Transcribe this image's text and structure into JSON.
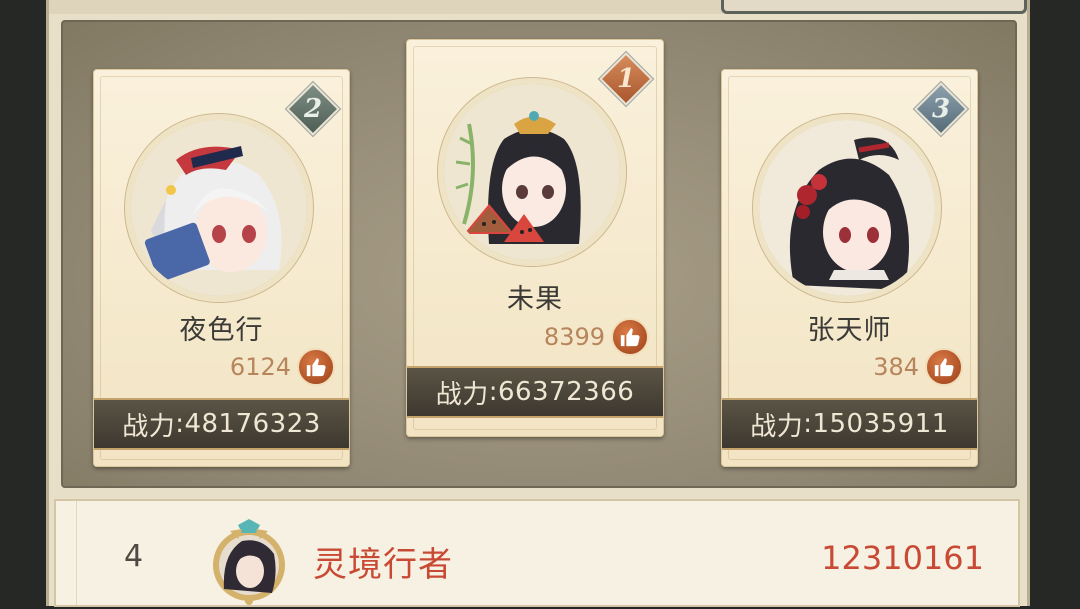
{
  "top3": [
    {
      "rank": "2",
      "name": "夜色行",
      "likes": "6124",
      "power_label": "战力",
      "power": "48176323"
    },
    {
      "rank": "1",
      "name": "未果",
      "likes": "8399",
      "power_label": "战力",
      "power": "66372366"
    },
    {
      "rank": "3",
      "name": "张天师",
      "likes": "384",
      "power_label": "战力",
      "power": "15035911"
    }
  ],
  "list": [
    {
      "rank": "4",
      "name": "灵境行者",
      "power": "12310161"
    }
  ],
  "colors": {
    "panel": "#e8dfc8",
    "podium": "#8f8672",
    "card": "#faf1dc",
    "name_red": "#c84a34",
    "like_orange": "#b7855c"
  },
  "icons": [
    "thumbs-up-icon",
    "rank-2-badge-icon",
    "rank-1-badge-icon",
    "rank-3-badge-icon"
  ]
}
